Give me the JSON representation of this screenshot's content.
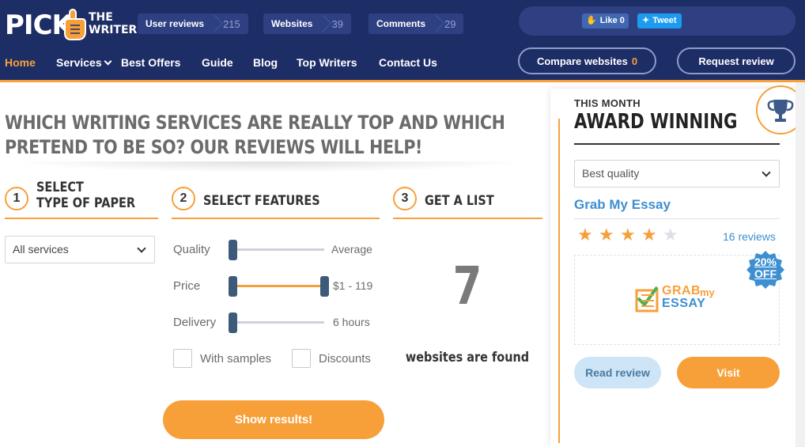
{
  "header": {
    "logo": {
      "pick": "PICK",
      "the": "THE",
      "writer": "WRITER"
    },
    "stats": [
      {
        "label": "User reviews",
        "value": "215"
      },
      {
        "label": "Websites",
        "value": "39"
      },
      {
        "label": "Comments",
        "value": "29"
      }
    ],
    "social": {
      "like_label": "Like 0",
      "tweet_label": "Tweet"
    },
    "nav": [
      {
        "label": "Home",
        "active": true
      },
      {
        "label": "Services",
        "has_dropdown": true
      },
      {
        "label": "Best Offers"
      },
      {
        "label": "Guide"
      },
      {
        "label": "Blog"
      },
      {
        "label": "Top Writers"
      },
      {
        "label": "Contact Us"
      }
    ],
    "compare_label": "Compare websites",
    "compare_count": "0",
    "request_label": "Request review"
  },
  "main": {
    "headline_line1": "WHICH WRITING SERVICES ARE REALLY TOP AND WHICH",
    "headline_line2": "PRETEND TO BE SO? OUR REVIEWS WILL HELP!",
    "steps": [
      {
        "num": "1",
        "title_line1": "SELECT",
        "title_line2": "TYPE OF PAPER"
      },
      {
        "num": "2",
        "title": "SELECT FEATURES"
      },
      {
        "num": "3",
        "title": "GET A LIST"
      }
    ],
    "paper_select": "All services",
    "features": [
      {
        "label": "Quality",
        "value": "Average"
      },
      {
        "label": "Price",
        "value": "$1 - 119"
      },
      {
        "label": "Delivery",
        "value": "6 hours"
      }
    ],
    "checkboxes": [
      {
        "label": "With samples",
        "checked": false
      },
      {
        "label": "Discounts",
        "checked": false
      }
    ],
    "show_button": "Show results!",
    "result_count": "7",
    "result_text": "websites are found"
  },
  "panel": {
    "this_month": "THIS MONTH",
    "title": "AWARD WINNING",
    "sort_select": "Best quality",
    "brand": "Grab My Essay",
    "rating": 4,
    "reviews": "16 reviews",
    "badge_line1": "20%",
    "badge_line2": "OFF",
    "logo_word1": "GRAB",
    "logo_word2": "my",
    "logo_word3": "ESSAY",
    "read_button": "Read review",
    "visit_button": "Visit"
  },
  "colors": {
    "header_bg": "#1d2d66",
    "accent": "#f7a03a",
    "link": "#3d8fd1"
  }
}
